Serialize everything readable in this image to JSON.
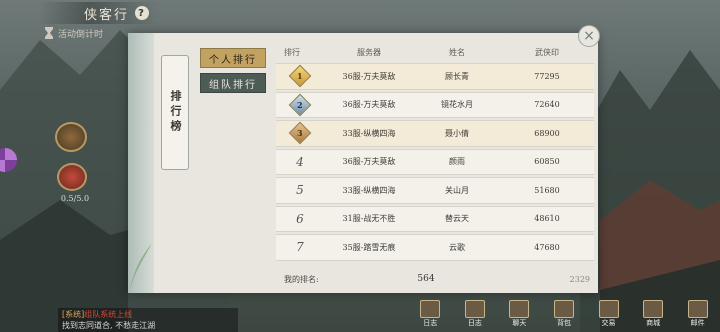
{
  "header": {
    "title": "侠客行",
    "help_icon": "?",
    "timer_label": "活动倒计时"
  },
  "side": {
    "gift_label": "0.5/5.0"
  },
  "panel": {
    "title": "排行榜",
    "close_icon": "×",
    "tabs": [
      {
        "label": "个人排行",
        "active": true
      },
      {
        "label": "组队排行",
        "active": false
      }
    ],
    "columns": [
      "排行",
      "服务器",
      "姓名",
      "武侠印"
    ],
    "rows": [
      {
        "rank": "1",
        "server": "36服-万夫莫敌",
        "name": "顾长青",
        "score": "77295"
      },
      {
        "rank": "2",
        "server": "36服-万夫莫敌",
        "name": "镜花水月",
        "score": "72640"
      },
      {
        "rank": "3",
        "server": "33服-纵横四海",
        "name": "聂小倩",
        "score": "68900"
      },
      {
        "rank": "4",
        "server": "36服-万夫莫敌",
        "name": "颜雨",
        "score": "60850"
      },
      {
        "rank": "5",
        "server": "33服-纵横四海",
        "name": "关山月",
        "score": "51680"
      },
      {
        "rank": "6",
        "server": "31服-战无不胜",
        "name": "替云天",
        "score": "48610"
      },
      {
        "rank": "7",
        "server": "35服-踏雪无痕",
        "name": "云歌",
        "score": "47680"
      }
    ],
    "my_rank_label": "我的排名:",
    "my_rank_value": "564",
    "my_rank_score": "2329"
  },
  "chat": {
    "line1_tag": "[系统]",
    "line1_text": "组队系统上线",
    "line2_text": "找到志同道合, 不愁走江湖"
  },
  "nav": {
    "items": [
      "日志",
      "日志",
      "聊天",
      "背包",
      "交易",
      "商城",
      "邮件"
    ]
  }
}
